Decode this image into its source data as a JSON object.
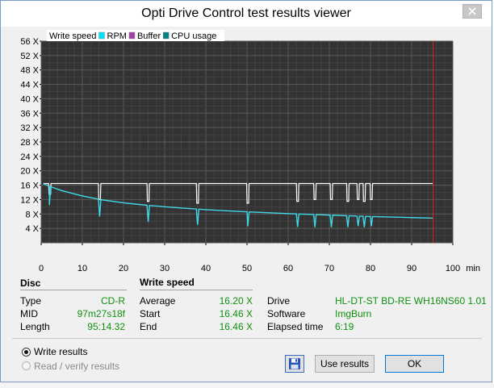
{
  "window": {
    "title": "Opti Drive Control test results viewer"
  },
  "background": {
    "strip_chars": [
      "0",
      "8",
      "0",
      "8"
    ]
  },
  "legend": [
    {
      "label": "Write speed",
      "color": "#ffffff"
    },
    {
      "label": "RPM",
      "color": "#00e5ff"
    },
    {
      "label": "Buffer",
      "color": "#a040a0"
    },
    {
      "label": "CPU usage",
      "color": "#008080"
    }
  ],
  "chart_data": {
    "type": "line",
    "x_unit": "min",
    "xlim": [
      0,
      100
    ],
    "ylim": [
      0,
      56
    ],
    "x_ticks": [
      "0",
      "10",
      "20",
      "30",
      "40",
      "50",
      "60",
      "70",
      "80",
      "90",
      "100"
    ],
    "y_ticks": [
      "56 X",
      "52 X",
      "48 X",
      "44 X",
      "40 X",
      "36 X",
      "32 X",
      "28 X",
      "24 X",
      "20 X",
      "16 X",
      "12 X",
      "8 X",
      "4 X"
    ],
    "grid": true,
    "background": "#333333",
    "end_marker_x": 95.2,
    "end_marker_color": "#e02020",
    "series": [
      {
        "name": "Write speed",
        "color": "#ffffff",
        "x": [
          0.5,
          95.2
        ],
        "y": [
          16.46,
          16.46
        ],
        "dips": [
          {
            "x": 2.1,
            "y": 13.5
          },
          {
            "x": 14.2,
            "y": 12.0
          },
          {
            "x": 26.0,
            "y": 11.5
          },
          {
            "x": 38.0,
            "y": 11.0
          },
          {
            "x": 50.2,
            "y": 11.0
          },
          {
            "x": 62.3,
            "y": 11.5
          },
          {
            "x": 66.5,
            "y": 12.0
          },
          {
            "x": 70.5,
            "y": 12.0
          },
          {
            "x": 74.5,
            "y": 11.5
          },
          {
            "x": 77.0,
            "y": 12.0
          },
          {
            "x": 78.5,
            "y": 11.5
          },
          {
            "x": 80.2,
            "y": 12.0
          }
        ]
      },
      {
        "name": "RPM",
        "color": "#40d8e8",
        "x": [
          0.5,
          2,
          5,
          10,
          15,
          20,
          25,
          30,
          35,
          40,
          45,
          50,
          55,
          60,
          65,
          70,
          75,
          80,
          85,
          90,
          95.2
        ],
        "y": [
          16.4,
          15.7,
          14.5,
          13.0,
          11.9,
          11.1,
          10.5,
          10.0,
          9.6,
          9.2,
          8.9,
          8.6,
          8.35,
          8.1,
          7.9,
          7.7,
          7.5,
          7.3,
          7.15,
          7.0,
          6.85
        ],
        "dips": [
          {
            "x": 2.0,
            "y": 10.5
          },
          {
            "x": 14.2,
            "y": 7.3
          },
          {
            "x": 26.0,
            "y": 5.8
          },
          {
            "x": 38.0,
            "y": 5.0
          },
          {
            "x": 50.2,
            "y": 4.6
          },
          {
            "x": 62.3,
            "y": 4.4
          },
          {
            "x": 66.5,
            "y": 4.3
          },
          {
            "x": 70.5,
            "y": 4.3
          },
          {
            "x": 74.5,
            "y": 4.3
          },
          {
            "x": 77.0,
            "y": 4.6
          },
          {
            "x": 78.5,
            "y": 4.3
          },
          {
            "x": 80.2,
            "y": 4.6
          }
        ]
      }
    ]
  },
  "disc": {
    "header": "Disc",
    "rows": [
      {
        "label": "Type",
        "value": "CD-R"
      },
      {
        "label": "MID",
        "value": "97m27s18f"
      },
      {
        "label": "Length",
        "value": "95:14.32"
      }
    ]
  },
  "write_speed": {
    "header": "Write speed",
    "rows": [
      {
        "label": "Average",
        "value": "16.20 X"
      },
      {
        "label": "Start",
        "value": "16.46 X"
      },
      {
        "label": "End",
        "value": "16.46 X"
      }
    ]
  },
  "drive": {
    "rows": [
      {
        "label": "Drive",
        "value": "HL-DT-ST  BD-RE  WH16NS60 1.01"
      },
      {
        "label": "Software",
        "value": "ImgBurn"
      },
      {
        "label": "Elapsed time",
        "value": "6:19"
      }
    ]
  },
  "options": {
    "write_results": "Write results",
    "read_verify_results": "Read / verify results"
  },
  "buttons": {
    "use_results": "Use results",
    "ok": "OK"
  }
}
